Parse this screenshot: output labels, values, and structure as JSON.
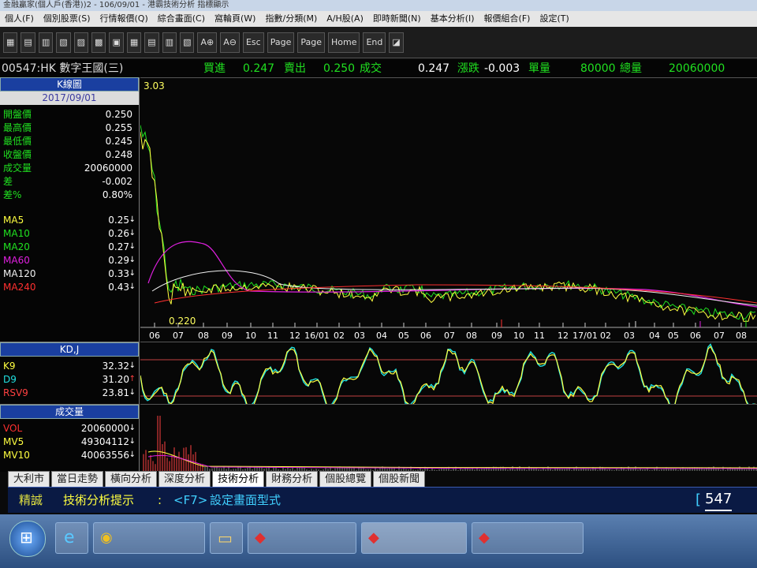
{
  "window": {
    "title": "金融贏家(個人戶(香港))2 - 106/09/01 - 港霸技術分析 指標顯示"
  },
  "menu": [
    "個人(F)",
    "個別股票(S)",
    "行情報價(Q)",
    "綜合畫面(C)",
    "窩輪頁(W)",
    "指數/分類(M)",
    "A/H股(A)",
    "即時新聞(N)",
    "基本分析(I)",
    "報價組合(F)",
    "設定(T)"
  ],
  "toolbar": {
    "zoom_in": "A⊕",
    "zoom_out": "A⊖",
    "esc": "Esc",
    "page_up": "Page",
    "page_down": "Page",
    "home": "Home",
    "end": "End"
  },
  "quote": {
    "code": "00547:HK 數字王國(三)",
    "buy_label": "買進",
    "buy": "0.247",
    "sell_label": "賣出",
    "sell": "0.250",
    "trade_label": "成交",
    "trade": "0.247",
    "change_label": "漲跌",
    "change": "-0.003",
    "vol_label": "單量",
    "vol": "80000",
    "total_label": "總量",
    "total": "20060000"
  },
  "kline_panel": {
    "title": "K線圖",
    "date": "2017/09/01",
    "rows": [
      {
        "label": "開盤價",
        "value": "0.250",
        "color": "#20e020"
      },
      {
        "label": "最高價",
        "value": "0.255",
        "color": "#20e020"
      },
      {
        "label": "最低價",
        "value": "0.245",
        "color": "#20e020"
      },
      {
        "label": "收盤價",
        "value": "0.248",
        "color": "#20e020"
      },
      {
        "label": "成交量",
        "value": "20060000",
        "color": "#20e020"
      },
      {
        "label": "差",
        "value": "-0.002",
        "color": "#20e020"
      },
      {
        "label": "差%",
        "value": "0.80%",
        "color": "#20e020"
      }
    ],
    "ma": [
      {
        "label": "MA5",
        "value": "0.25",
        "arrow": "↓",
        "color": "#ffff40"
      },
      {
        "label": "MA10",
        "value": "0.26",
        "arrow": "↓",
        "color": "#20e020"
      },
      {
        "label": "MA20",
        "value": "0.27",
        "arrow": "↓",
        "color": "#20e020"
      },
      {
        "label": "MA60",
        "value": "0.29",
        "arrow": "↓",
        "color": "#e020e0"
      },
      {
        "label": "MA120",
        "value": "0.33",
        "arrow": "↓",
        "color": "#f0f0f0"
      },
      {
        "label": "MA240",
        "value": "0.43",
        "arrow": "↓",
        "color": "#ff3030"
      }
    ]
  },
  "kdj_panel": {
    "title": "KD,J",
    "rows": [
      {
        "label": "K9",
        "value": "32.32",
        "arrow": "↓",
        "color": "#ffff40"
      },
      {
        "label": "D9",
        "value": "31.20",
        "arrow": "↑",
        "color": "#20e0e0"
      },
      {
        "label": "RSV9",
        "value": "23.81",
        "arrow": "↓",
        "color": "#ff4040"
      }
    ]
  },
  "volume_panel": {
    "title": "成交量",
    "rows": [
      {
        "label": "VOL",
        "value": "20060000",
        "arrow": "↓",
        "color": "#ff3030"
      },
      {
        "label": "MV5",
        "value": "49304112",
        "arrow": "↓",
        "color": "#ffff40"
      },
      {
        "label": "MV10",
        "value": "40063556",
        "arrow": "↓",
        "color": "#ffff40"
      }
    ]
  },
  "chart_data": {
    "type": "line",
    "price_high_label": "3.03",
    "price_low_label": "0.220",
    "x_ticks": [
      "06",
      "07",
      "08",
      "09",
      "10",
      "11",
      "12",
      "16/01",
      "02",
      "03",
      "04",
      "05",
      "06",
      "07",
      "08",
      "09",
      "10",
      "11",
      "12",
      "17/01",
      "02",
      "03",
      "04",
      "05",
      "06",
      "07",
      "08"
    ],
    "kd_band_high": 80,
    "kd_band_low": 20
  },
  "tabs": [
    "大利市",
    "當日走勢",
    "橫向分析",
    "深度分析",
    "技術分析",
    "財務分析",
    "個股總覽",
    "個股新聞"
  ],
  "active_tab": 4,
  "hint": {
    "brand": "精誠",
    "label": "技術分析提示",
    "key": "<F7>",
    "text": "設定畫面型式"
  },
  "command": {
    "value": "547"
  }
}
